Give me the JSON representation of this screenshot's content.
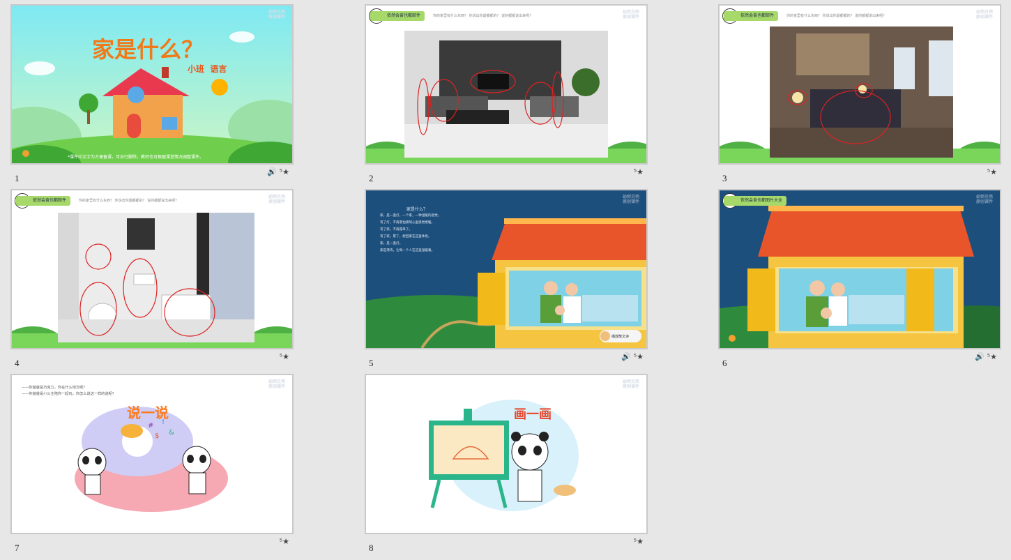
{
  "slides": [
    {
      "num": "1",
      "title": "家是什么？",
      "subtitle": "小班  语言",
      "note": "*课件中文字为方便备课，可自行删除，教师也可根据课堂情况调整课件。",
      "icons": [
        "speaker-icon",
        "star-transition-icon"
      ]
    },
    {
      "num": "2",
      "header_pill": "依然会奋也都邮件",
      "header_question": "你的家里有什么东西？ 你说出你最都都的？ 说的都都说出来呢？",
      "icons": [
        "star-transition-icon"
      ]
    },
    {
      "num": "3",
      "header_pill": "依然会奋也都邮件",
      "header_question": "你的家里有什么东西？ 你说出你最都都的？ 说的都都说出来呢？",
      "icons": [
        "star-transition-icon"
      ]
    },
    {
      "num": "4",
      "header_pill": "依然会奋也都邮件",
      "header_question": "你的家里有什么东西？ 你说出你最都都的？ 说的都都说出来呢？",
      "icons": [
        "star-transition-icon"
      ]
    },
    {
      "num": "5",
      "poem_title": "家是什么？",
      "poem_lines": [
        "家，是一盏灯，一个家，一种温暖的感觉。",
        "有了灯，不再害怕黑暗心里感觉更暖。",
        "有了家，不再孤单了。",
        "有了家，累了，想回家在这里休息。",
        "家，是一盏灯。",
        "家是港湾，让每一个人在这里温暖着。"
      ],
      "button": "播放散文诗",
      "icons": [
        "speaker-icon",
        "star-transition-icon"
      ]
    },
    {
      "num": "6",
      "header_pill": "依然会奋也都图片大全",
      "icons": [
        "speaker-icon",
        "star-transition-icon"
      ]
    },
    {
      "num": "7",
      "lines": [
        "——你爸爸是巧克力，你在什么地方呢？",
        "——你爸爸是小公主陪你一起玩，你怎么说这一样的说呢？"
      ],
      "title": "说一说",
      "icons": [
        "star-transition-icon"
      ]
    },
    {
      "num": "8",
      "title": "画一画",
      "icons": [
        "star-transition-icon"
      ]
    }
  ],
  "logo_text": [
    "幼师贝壳",
    "原创课件"
  ],
  "colors": {
    "title_orange": "#f07a1a",
    "pill_green": "#a6d96a",
    "sky": "#7ee6f2",
    "grass": "#6fcf4c",
    "night": "#1b4a78",
    "roof": "#e9552a"
  }
}
